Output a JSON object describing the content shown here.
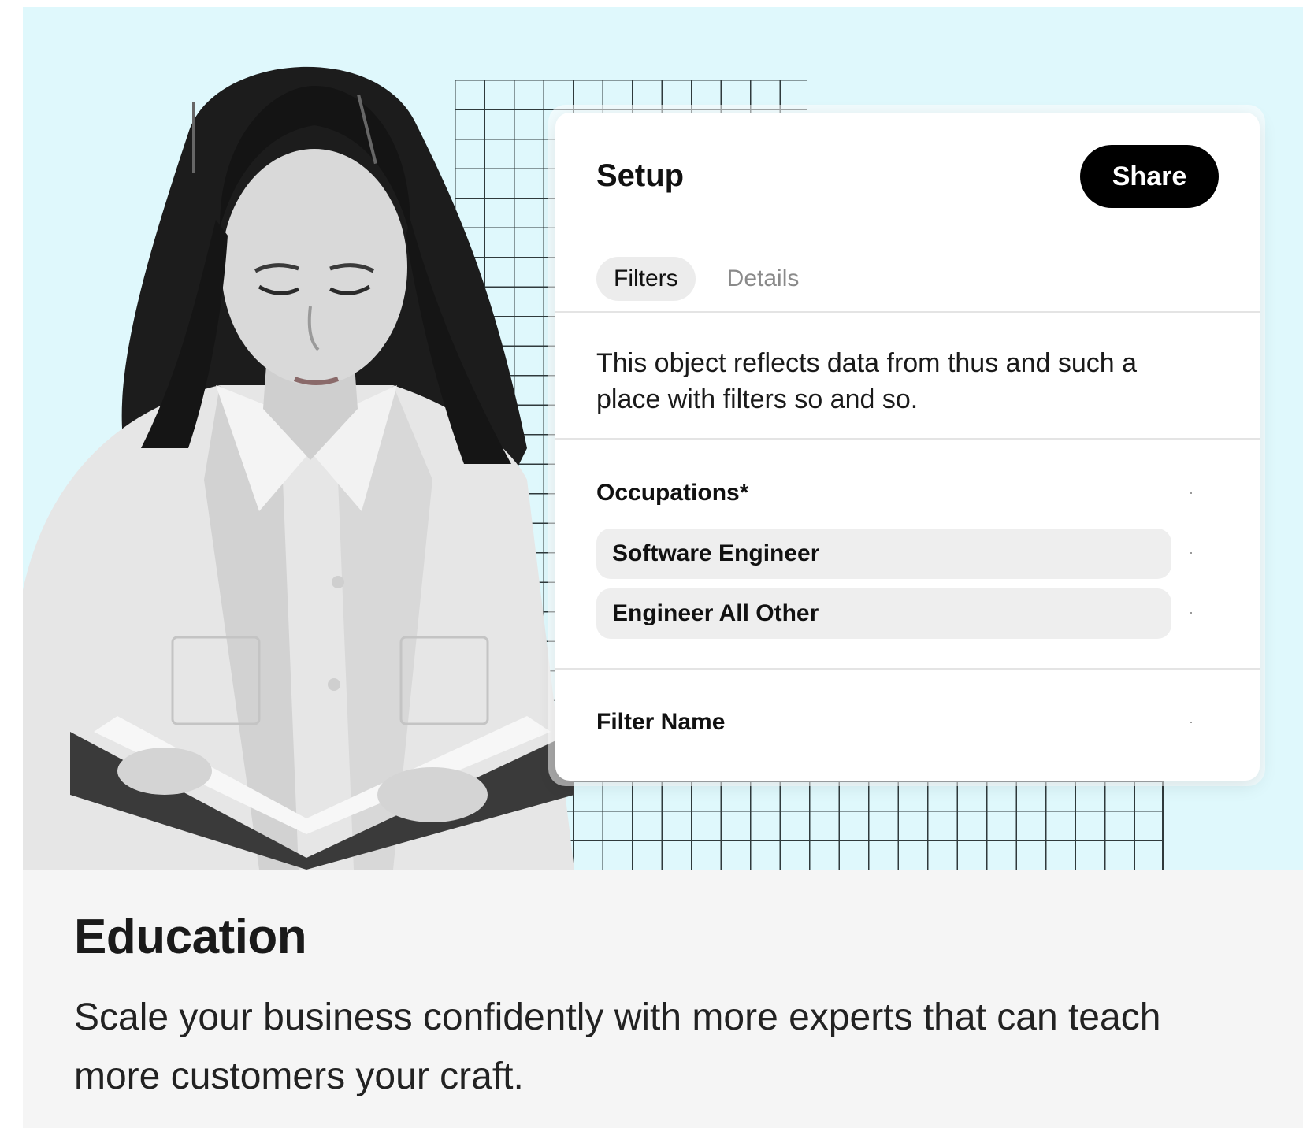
{
  "card": {
    "title": "Setup",
    "share_label": "Share",
    "tabs": [
      {
        "label": "Filters",
        "active": true
      },
      {
        "label": "Details",
        "active": false
      }
    ],
    "description": "This object reflects data from thus and such a place with filters so and so.",
    "occupations": {
      "label": "Occupations*",
      "items": [
        "Software Engineer",
        "Engineer All Other"
      ]
    },
    "filter_name": {
      "label": "Filter Name"
    }
  },
  "section": {
    "title": "Education",
    "description": "Scale your business confidently with more experts that can teach more customers your craft."
  },
  "colors": {
    "hero_background": "#dff8fc",
    "grid_line": "#2f3a3c",
    "share_button": "#000000",
    "chip_background": "#eeeeee",
    "bottom_background": "#f5f5f5"
  }
}
